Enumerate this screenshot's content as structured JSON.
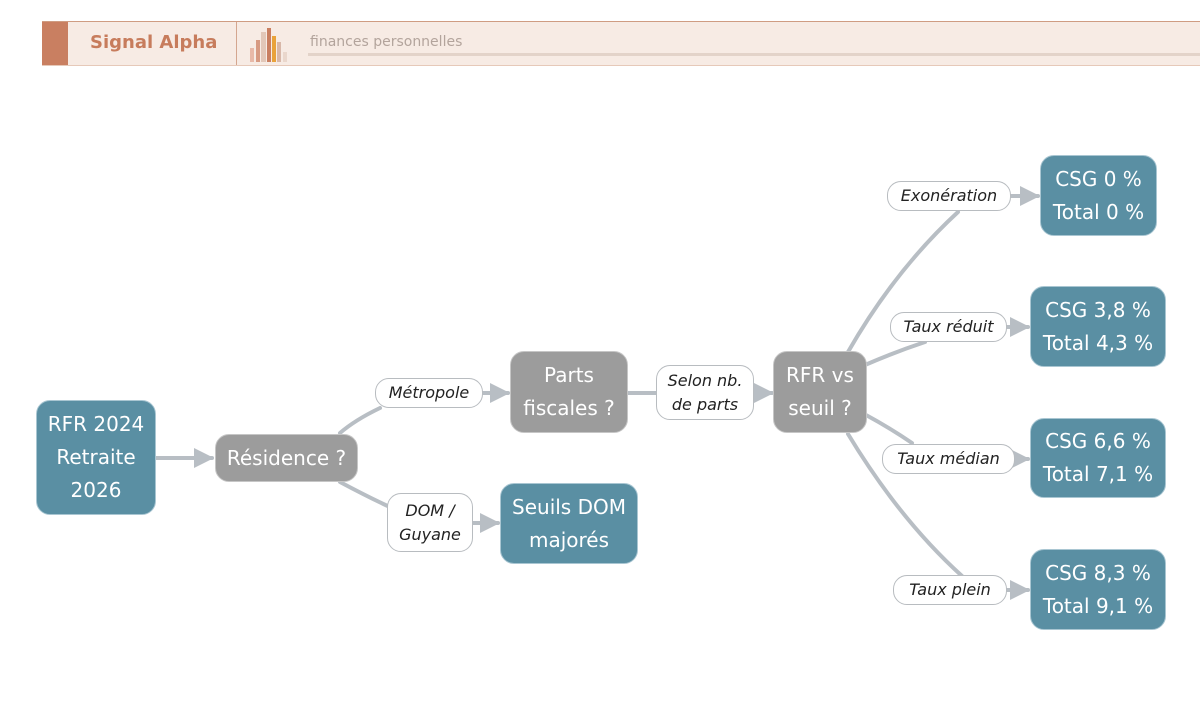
{
  "header": {
    "brand": "Signal Alpha",
    "tagline": "finances personnelles"
  },
  "colors": {
    "accent": "#c97f61",
    "node_blue": "#5a8fa3",
    "node_gray": "#9c9c9c",
    "edge": "#b8bec4"
  },
  "diagram": {
    "nodes": {
      "start": "RFR 2024\nRetraite\n2026",
      "residence": "Résidence ?",
      "parts": "Parts\nfiscales ?",
      "dom": "Seuils DOM\nmajorés",
      "rfr": "RFR vs\nseuil ?",
      "csg0": "CSG 0 %\nTotal 0 %",
      "csg38": "CSG 3,8 %\nTotal 4,3 %",
      "csg66": "CSG 6,6 %\nTotal 7,1 %",
      "csg83": "CSG 8,3 %\nTotal 9,1 %"
    },
    "labels": {
      "metropole": "Métropole",
      "dom_guyane": "DOM /\nGuyane",
      "selon": "Selon nb.\nde parts",
      "exoneration": "Exonération",
      "taux_reduit": "Taux réduit",
      "taux_median": "Taux médian",
      "taux_plein": "Taux plein"
    }
  }
}
